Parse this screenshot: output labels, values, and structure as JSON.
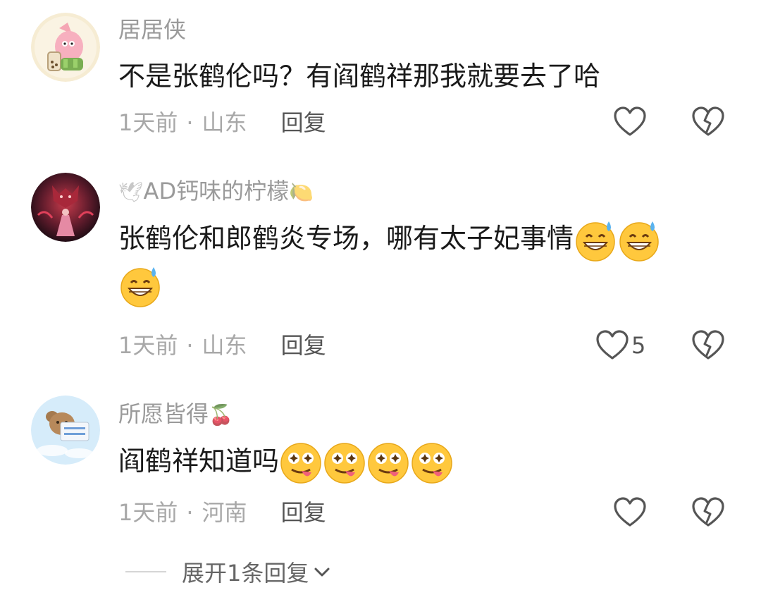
{
  "comments": [
    {
      "username": "居居侠",
      "username_prefix": "",
      "username_suffix": "",
      "text": "不是张鹤伦吗？有阎鹤祥那我就要去了哈",
      "emojis": [],
      "time": "1天前",
      "dot": "·",
      "location": "山东",
      "reply_label": "回复",
      "likes": ""
    },
    {
      "username": "AD钙味的柠檬",
      "username_prefix": "🕊",
      "username_suffix": "🍋",
      "text": "张鹤伦和郎鹤炎专场，哪有太子妃事情",
      "emojis": [
        "grin-sweat",
        "grin-sweat",
        "grin-sweat"
      ],
      "time": "1天前",
      "dot": "·",
      "location": "山东",
      "reply_label": "回复",
      "likes": "5"
    },
    {
      "username": "所愿皆得",
      "username_prefix": "",
      "username_suffix": "🍒",
      "text": "阎鹤祥知道吗",
      "emojis": [
        "star-eyes-tongue",
        "star-eyes-tongue",
        "star-eyes-tongue",
        "star-eyes-tongue"
      ],
      "time": "1天前",
      "dot": "·",
      "location": "河南",
      "reply_label": "回复",
      "likes": ""
    }
  ],
  "expand_replies": "展开1条回复",
  "icons": {
    "like": "heart-outline-icon",
    "dislike": "broken-heart-icon",
    "expand": "chevron-down-icon"
  },
  "colors": {
    "text": "#1a1a1a",
    "muted": "#a8a8a8",
    "icon": "#555555"
  }
}
